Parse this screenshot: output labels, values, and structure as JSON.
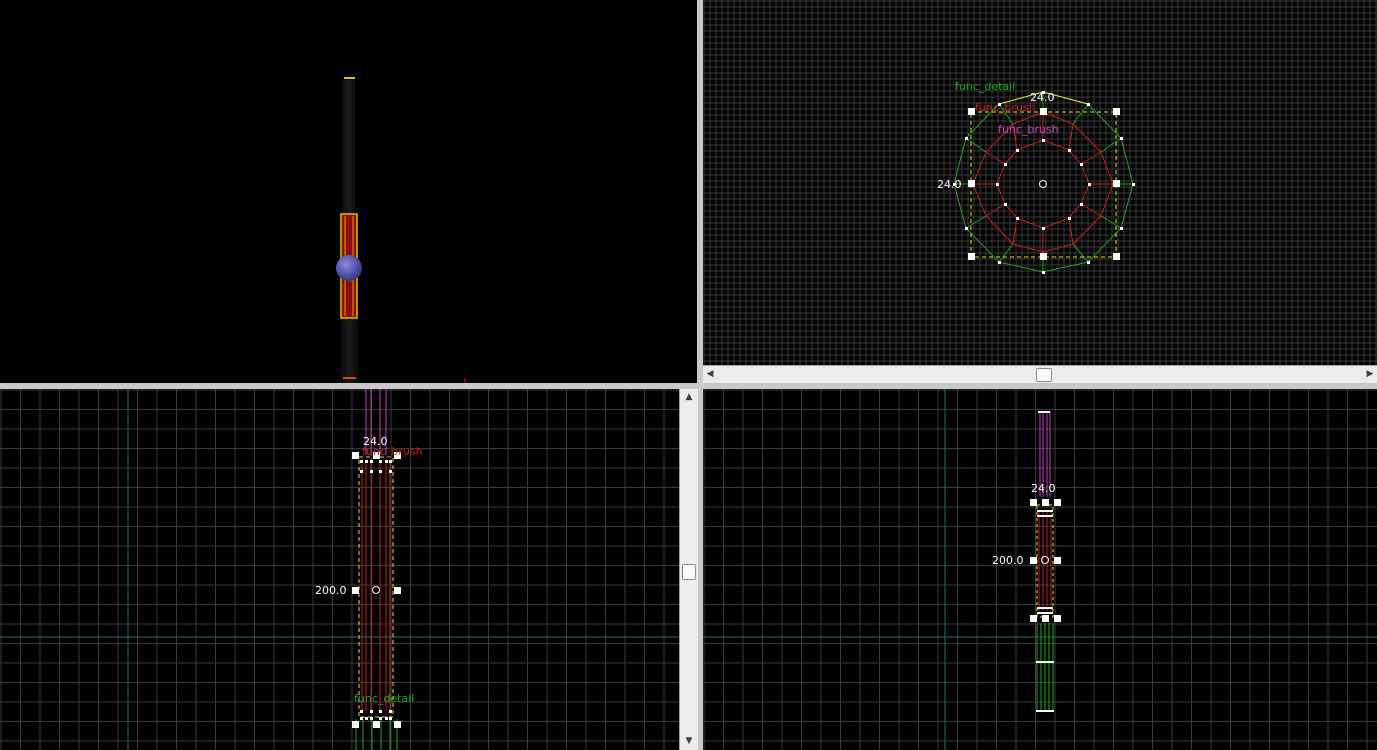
{
  "viewports": {
    "top": {
      "dim_width": "24.0",
      "dim_height": "24.0",
      "entities": [
        "func_detail",
        "func_brush",
        "func_brush"
      ]
    },
    "front": {
      "dim_width": "24.0",
      "dim_height": "200.0",
      "entities": [
        "func_brush",
        "func_detail"
      ]
    },
    "side": {
      "dim_width": "24.0",
      "dim_height": "200.0"
    }
  },
  "colors": {
    "grid": "#3a3a3a",
    "grid_major": "#1f6f6f",
    "detail": "#1fa51f",
    "brush_red": "#c81e1e",
    "brush_magenta": "#c83cc8",
    "selection_yellow": "#e6e61e",
    "handle": "#ffffff"
  },
  "icons": [
    "left-arrow-icon",
    "right-arrow-icon",
    "up-arrow-icon",
    "down-arrow-icon",
    "center-point-icon"
  ]
}
